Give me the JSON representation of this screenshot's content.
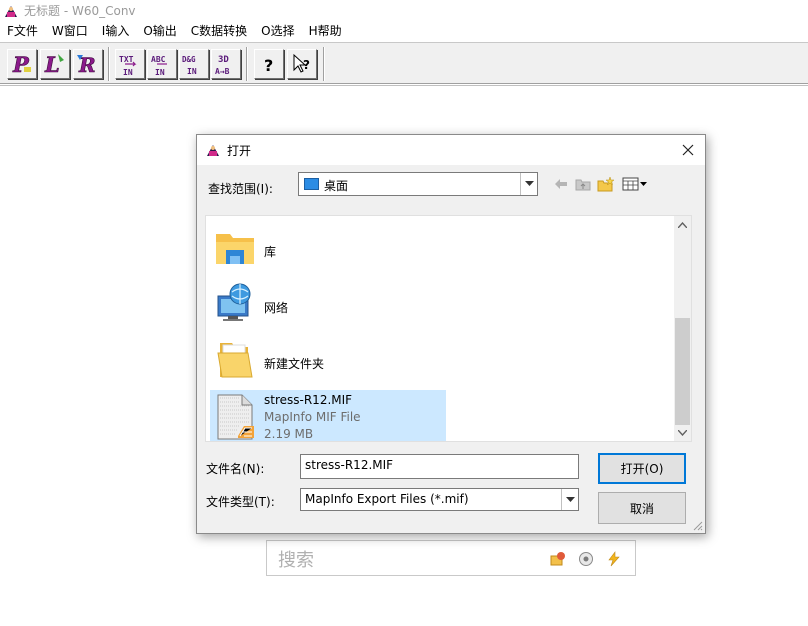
{
  "app": {
    "title": "无标题 - W60_Conv",
    "menu": [
      "F文件",
      "W窗口",
      "I输入",
      "O输出",
      "C数据转换",
      "O选择",
      "H帮助"
    ],
    "toolbar": [
      {
        "name": "p-tool-button",
        "glyph": "P"
      },
      {
        "name": "l-tool-button",
        "glyph": "L"
      },
      {
        "name": "r-tool-button",
        "glyph": "R"
      },
      {
        "name": "txt-convert-button",
        "glyph": "TXT"
      },
      {
        "name": "abc-convert-button",
        "glyph": "ABC"
      },
      {
        "name": "dg-convert-button",
        "glyph": "D&G"
      },
      {
        "name": "3d-convert-button",
        "glyph": "3D"
      },
      {
        "name": "help-button",
        "glyph": "?"
      },
      {
        "name": "context-help-button",
        "glyph": "?"
      }
    ]
  },
  "search": {
    "placeholder": "搜索"
  },
  "dialog": {
    "title": "打开",
    "look_in_label": "查找范围(I):",
    "look_in_value": "桌面",
    "files": [
      {
        "name": "库",
        "icon": "library-folder-icon"
      },
      {
        "name": "网络",
        "icon": "network-icon"
      },
      {
        "name": "新建文件夹",
        "icon": "folder-icon"
      },
      {
        "name": "stress-R12.MIF",
        "type": "MapInfo MIF File",
        "size": "2.19 MB",
        "icon": "mif-file-icon",
        "selected": true
      }
    ],
    "filename_label": "文件名(N):",
    "filename_value": "stress-R12.MIF",
    "filetype_label": "文件类型(T):",
    "filetype_value": "MapInfo Export Files (*.mif)",
    "open_button": "打开(O)",
    "cancel_button": "取消"
  }
}
